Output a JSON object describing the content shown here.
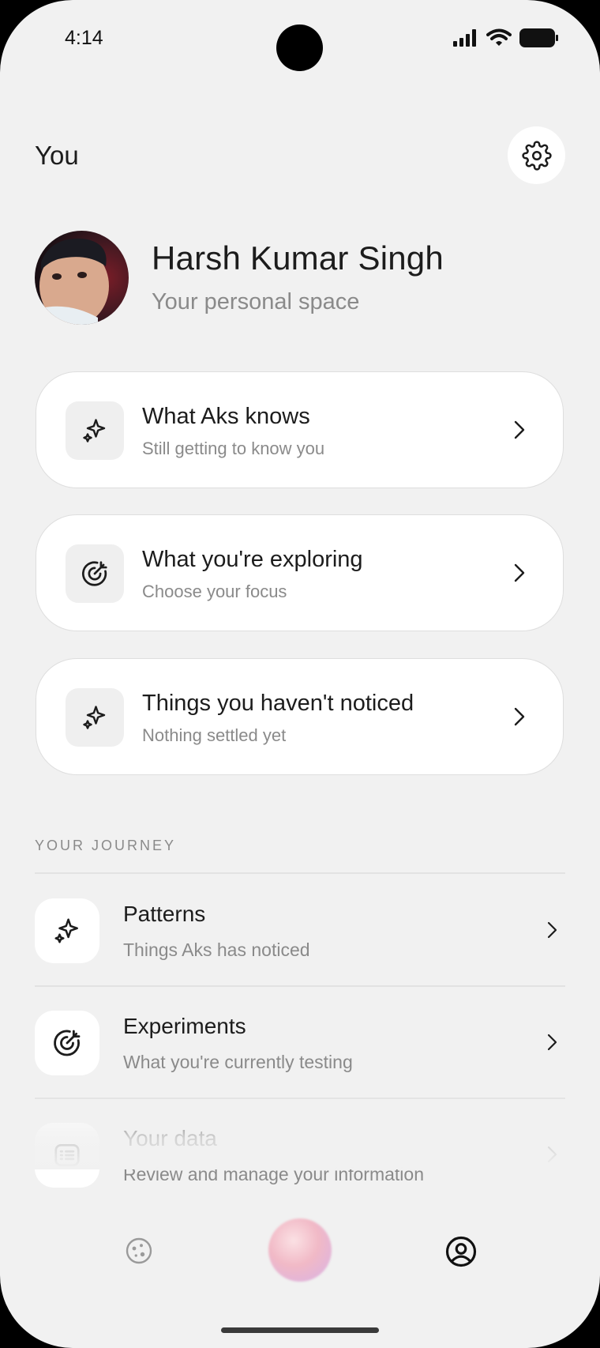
{
  "status_bar": {
    "time": "4:14"
  },
  "header": {
    "title": "You"
  },
  "profile": {
    "name": "Harsh Kumar Singh",
    "subtitle": "Your personal space"
  },
  "cards": [
    {
      "title": "What Aks knows",
      "subtitle": "Still getting to know you",
      "icon": "sparkle-icon"
    },
    {
      "title": "What you're exploring",
      "subtitle": "Choose your focus",
      "icon": "target-icon"
    },
    {
      "title": "Things you haven't noticed",
      "subtitle": "Nothing settled yet",
      "icon": "sparkle-icon"
    }
  ],
  "journey": {
    "label": "YOUR JOURNEY",
    "items": [
      {
        "title": "Patterns",
        "subtitle": "Things Aks has noticed",
        "icon": "sparkle-icon"
      },
      {
        "title": "Experiments",
        "subtitle": "What you're currently testing",
        "icon": "target-icon"
      },
      {
        "title": "Your data",
        "subtitle": "Review and manage your information",
        "icon": "list-icon"
      }
    ]
  },
  "tab_bar": {
    "items": [
      "explore-icon",
      "assistant-orb",
      "profile-icon"
    ]
  }
}
